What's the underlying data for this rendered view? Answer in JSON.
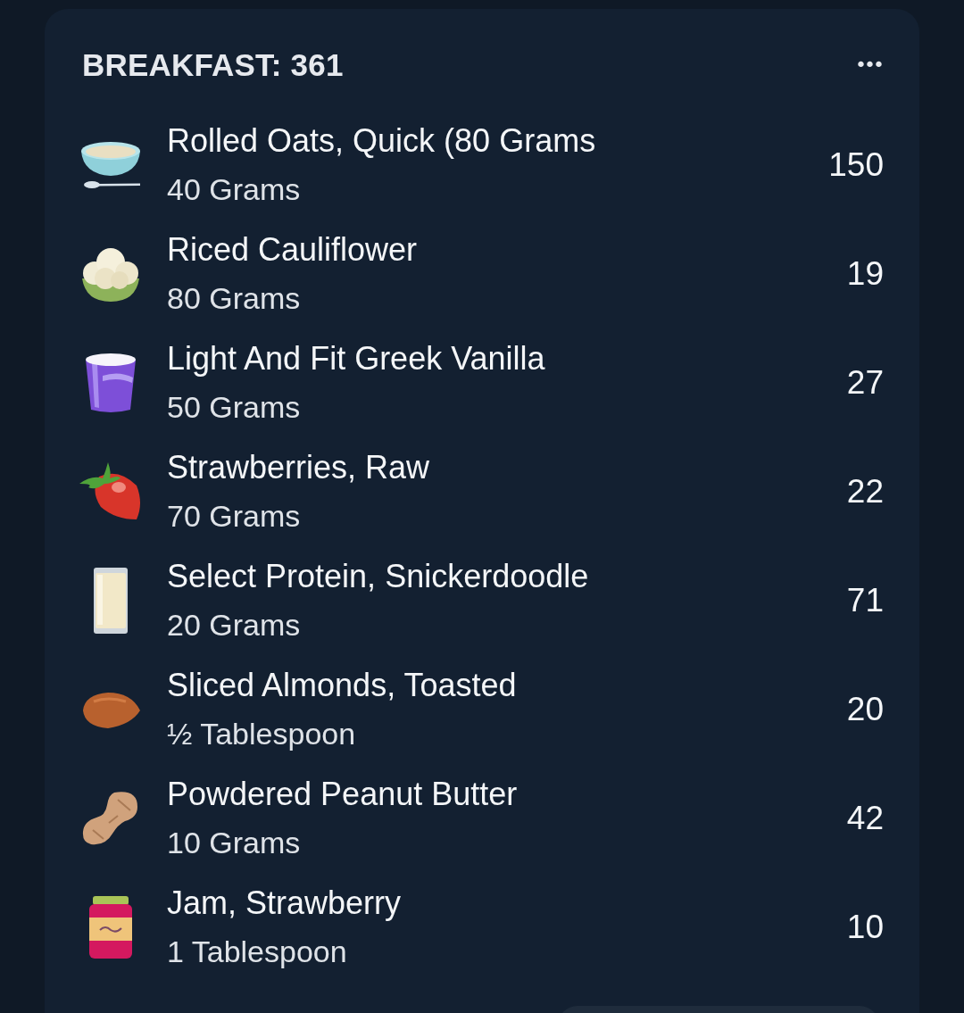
{
  "meal": {
    "title": "BREAKFAST: 361",
    "more_button": "•••"
  },
  "foods": [
    {
      "name": "Rolled Oats, Quick (80 Grams",
      "amount": "40 Grams",
      "calories": "150"
    },
    {
      "name": "Riced Cauliflower",
      "amount": "80 Grams",
      "calories": "19"
    },
    {
      "name": "Light And Fit Greek Vanilla",
      "amount": "50 Grams",
      "calories": "27"
    },
    {
      "name": "Strawberries, Raw",
      "amount": "70 Grams",
      "calories": "22"
    },
    {
      "name": "Select Protein, Snickerdoodle",
      "amount": "20 Grams",
      "calories": "71"
    },
    {
      "name": "Sliced Almonds, Toasted",
      "amount": "½ Tablespoon",
      "calories": "20"
    },
    {
      "name": "Powdered Peanut Butter",
      "amount": "10 Grams",
      "calories": "42"
    },
    {
      "name": "Jam, Strawberry",
      "amount": "1 Tablespoon",
      "calories": "10"
    }
  ]
}
